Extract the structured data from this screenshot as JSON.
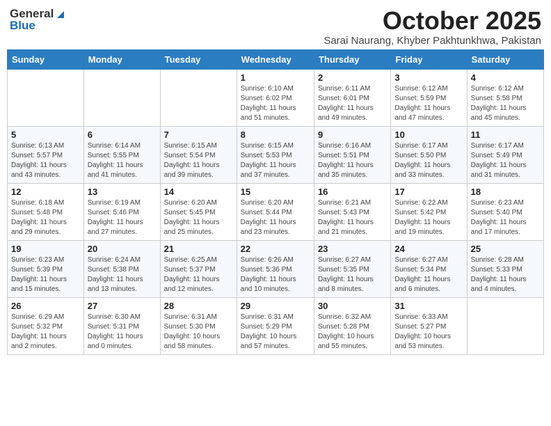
{
  "header": {
    "logo": {
      "general": "General",
      "blue": "Blue"
    },
    "title": "October 2025",
    "location": "Sarai Naurang, Khyber Pakhtunkhwa, Pakistan"
  },
  "weekdays": [
    "Sunday",
    "Monday",
    "Tuesday",
    "Wednesday",
    "Thursday",
    "Friday",
    "Saturday"
  ],
  "weeks": [
    [
      {
        "day": "",
        "info": ""
      },
      {
        "day": "",
        "info": ""
      },
      {
        "day": "",
        "info": ""
      },
      {
        "day": "1",
        "info": "Sunrise: 6:10 AM\nSunset: 6:02 PM\nDaylight: 11 hours\nand 51 minutes."
      },
      {
        "day": "2",
        "info": "Sunrise: 6:11 AM\nSunset: 6:01 PM\nDaylight: 11 hours\nand 49 minutes."
      },
      {
        "day": "3",
        "info": "Sunrise: 6:12 AM\nSunset: 5:59 PM\nDaylight: 11 hours\nand 47 minutes."
      },
      {
        "day": "4",
        "info": "Sunrise: 6:12 AM\nSunset: 5:58 PM\nDaylight: 11 hours\nand 45 minutes."
      }
    ],
    [
      {
        "day": "5",
        "info": "Sunrise: 6:13 AM\nSunset: 5:57 PM\nDaylight: 11 hours\nand 43 minutes."
      },
      {
        "day": "6",
        "info": "Sunrise: 6:14 AM\nSunset: 5:55 PM\nDaylight: 11 hours\nand 41 minutes."
      },
      {
        "day": "7",
        "info": "Sunrise: 6:15 AM\nSunset: 5:54 PM\nDaylight: 11 hours\nand 39 minutes."
      },
      {
        "day": "8",
        "info": "Sunrise: 6:15 AM\nSunset: 5:53 PM\nDaylight: 11 hours\nand 37 minutes."
      },
      {
        "day": "9",
        "info": "Sunrise: 6:16 AM\nSunset: 5:51 PM\nDaylight: 11 hours\nand 35 minutes."
      },
      {
        "day": "10",
        "info": "Sunrise: 6:17 AM\nSunset: 5:50 PM\nDaylight: 11 hours\nand 33 minutes."
      },
      {
        "day": "11",
        "info": "Sunrise: 6:17 AM\nSunset: 5:49 PM\nDaylight: 11 hours\nand 31 minutes."
      }
    ],
    [
      {
        "day": "12",
        "info": "Sunrise: 6:18 AM\nSunset: 5:48 PM\nDaylight: 11 hours\nand 29 minutes."
      },
      {
        "day": "13",
        "info": "Sunrise: 6:19 AM\nSunset: 5:46 PM\nDaylight: 11 hours\nand 27 minutes."
      },
      {
        "day": "14",
        "info": "Sunrise: 6:20 AM\nSunset: 5:45 PM\nDaylight: 11 hours\nand 25 minutes."
      },
      {
        "day": "15",
        "info": "Sunrise: 6:20 AM\nSunset: 5:44 PM\nDaylight: 11 hours\nand 23 minutes."
      },
      {
        "day": "16",
        "info": "Sunrise: 6:21 AM\nSunset: 5:43 PM\nDaylight: 11 hours\nand 21 minutes."
      },
      {
        "day": "17",
        "info": "Sunrise: 6:22 AM\nSunset: 5:42 PM\nDaylight: 11 hours\nand 19 minutes."
      },
      {
        "day": "18",
        "info": "Sunrise: 6:23 AM\nSunset: 5:40 PM\nDaylight: 11 hours\nand 17 minutes."
      }
    ],
    [
      {
        "day": "19",
        "info": "Sunrise: 6:23 AM\nSunset: 5:39 PM\nDaylight: 11 hours\nand 15 minutes."
      },
      {
        "day": "20",
        "info": "Sunrise: 6:24 AM\nSunset: 5:38 PM\nDaylight: 11 hours\nand 13 minutes."
      },
      {
        "day": "21",
        "info": "Sunrise: 6:25 AM\nSunset: 5:37 PM\nDaylight: 11 hours\nand 12 minutes."
      },
      {
        "day": "22",
        "info": "Sunrise: 6:26 AM\nSunset: 5:36 PM\nDaylight: 11 hours\nand 10 minutes."
      },
      {
        "day": "23",
        "info": "Sunrise: 6:27 AM\nSunset: 5:35 PM\nDaylight: 11 hours\nand 8 minutes."
      },
      {
        "day": "24",
        "info": "Sunrise: 6:27 AM\nSunset: 5:34 PM\nDaylight: 11 hours\nand 6 minutes."
      },
      {
        "day": "25",
        "info": "Sunrise: 6:28 AM\nSunset: 5:33 PM\nDaylight: 11 hours\nand 4 minutes."
      }
    ],
    [
      {
        "day": "26",
        "info": "Sunrise: 6:29 AM\nSunset: 5:32 PM\nDaylight: 11 hours\nand 2 minutes."
      },
      {
        "day": "27",
        "info": "Sunrise: 6:30 AM\nSunset: 5:31 PM\nDaylight: 11 hours\nand 0 minutes."
      },
      {
        "day": "28",
        "info": "Sunrise: 6:31 AM\nSunset: 5:30 PM\nDaylight: 10 hours\nand 58 minutes."
      },
      {
        "day": "29",
        "info": "Sunrise: 6:31 AM\nSunset: 5:29 PM\nDaylight: 10 hours\nand 57 minutes."
      },
      {
        "day": "30",
        "info": "Sunrise: 6:32 AM\nSunset: 5:28 PM\nDaylight: 10 hours\nand 55 minutes."
      },
      {
        "day": "31",
        "info": "Sunrise: 6:33 AM\nSunset: 5:27 PM\nDaylight: 10 hours\nand 53 minutes."
      },
      {
        "day": "",
        "info": ""
      }
    ]
  ]
}
